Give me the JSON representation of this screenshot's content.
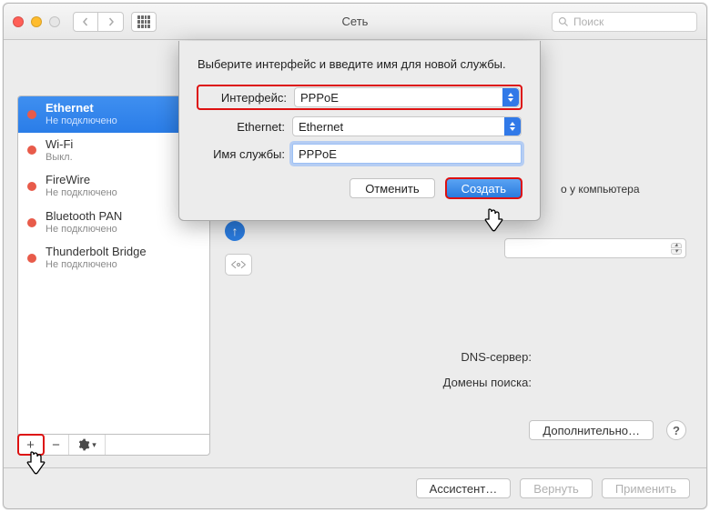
{
  "window": {
    "title": "Сеть",
    "search_placeholder": "Поиск"
  },
  "sidebar": {
    "items": [
      {
        "name": "Ethernet",
        "status": "Не подключено"
      },
      {
        "name": "Wi-Fi",
        "status": "Выкл."
      },
      {
        "name": "FireWire",
        "status": "Не подключено"
      },
      {
        "name": "Bluetooth PAN",
        "status": "Не подключено"
      },
      {
        "name": "Thunderbolt Bridge",
        "status": "Не подключено"
      }
    ],
    "footer": {
      "plus": "+",
      "minus": "−"
    }
  },
  "body": {
    "hint_fragment": "о у компьютера",
    "dns_label": "DNS-сервер:",
    "domains_label": "Домены поиска:",
    "advanced": "Дополнительно…"
  },
  "buttons": {
    "assistant": "Ассистент…",
    "revert": "Вернуть",
    "apply": "Применить"
  },
  "sheet": {
    "prompt": "Выберите интерфейс и введите имя для новой службы.",
    "interface_label": "Интерфейс:",
    "interface_value": "PPPoE",
    "ethernet_label": "Ethernet:",
    "ethernet_value": "Ethernet",
    "service_label": "Имя службы:",
    "service_value": "PPPoE",
    "cancel": "Отменить",
    "create": "Создать"
  }
}
